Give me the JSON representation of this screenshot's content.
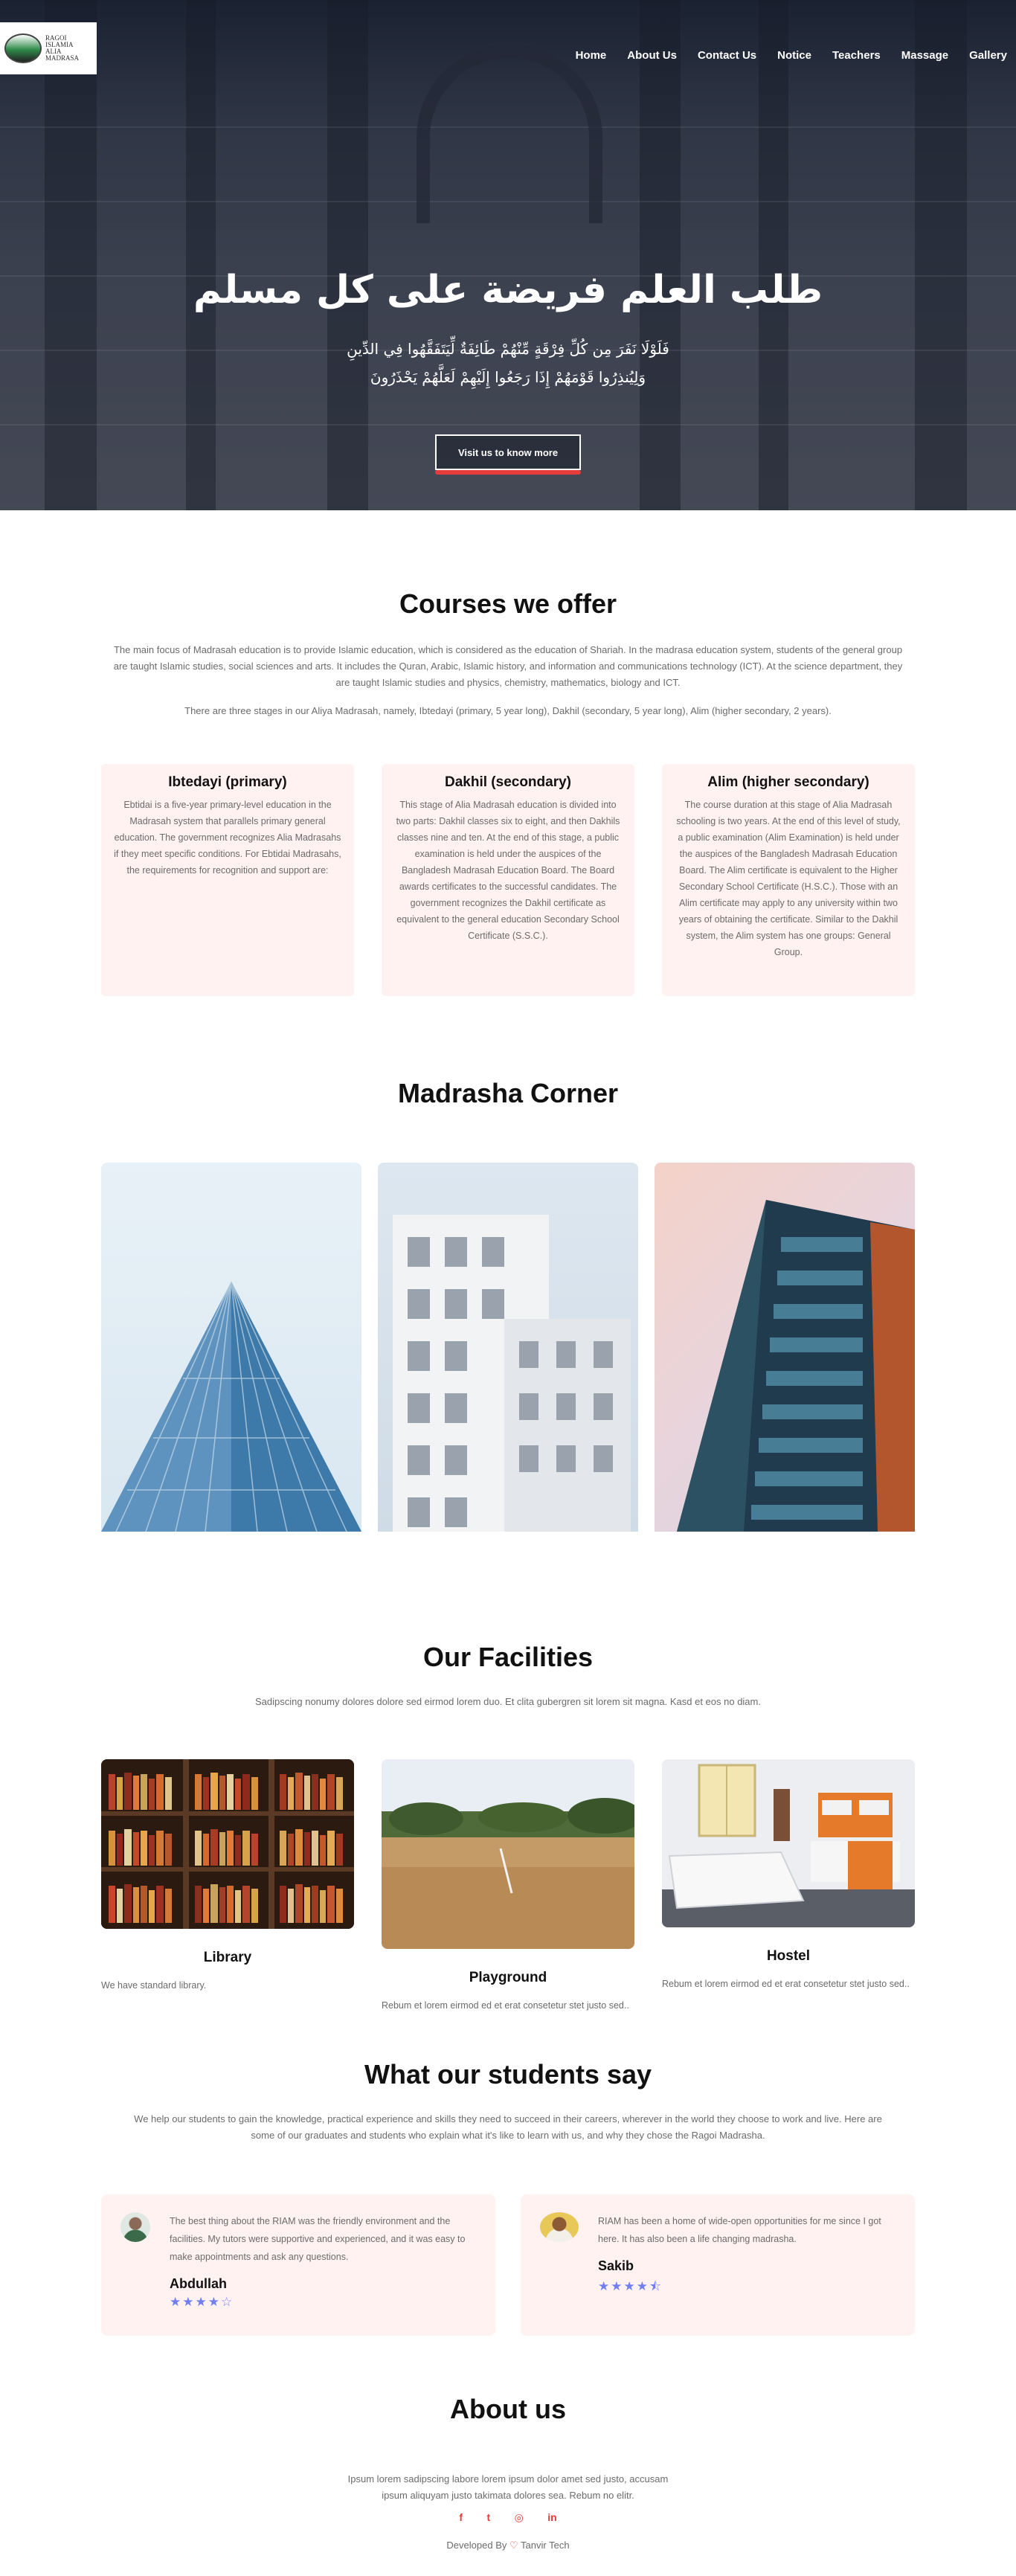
{
  "nav": {
    "logo_lines": [
      "RAGOI",
      "ISLAMIA",
      "ALIA",
      "MADRASA"
    ],
    "items": [
      "Home",
      "About Us",
      "Contact Us",
      "Notice",
      "Teachers",
      "Massage",
      "Gallery"
    ]
  },
  "hero": {
    "title": "طلب العلم فريضة على كل مسلم",
    "verse_line1": "فَلَوْلَا نَفَرَ مِن كُلِّ فِرْقَةٍ مِّنْهُمْ طَائِفَةٌ لِّيَتَفَقَّهُوا فِي الدِّينِ",
    "verse_line2": "وَلِيُنذِرُوا قَوْمَهُمْ إِذَا رَجَعُوا إِلَيْهِمْ لَعَلَّهُمْ يَحْذَرُونَ",
    "button_label": "Visit us to know more"
  },
  "courses": {
    "title": "Courses we offer",
    "intro": "The main focus of Madrasah education is to provide Islamic education, which is considered as the education of Shariah. In the madrasa education system, students of the general group are taught Islamic studies, social sciences and arts. It includes the Quran, Arabic, Islamic history, and information and communications technology (ICT). At the science department, they are taught Islamic studies and physics, chemistry, mathematics, biology and ICT.",
    "intro2": "There are three stages in our Aliya Madrasah, namely, Ibtedayi (primary, 5 year long), Dakhil (secondary, 5 year long), Alim (higher secondary, 2 years).",
    "cards": [
      {
        "title": "Ibtedayi (primary)",
        "text": "Ebtidai is a five-year primary-level education in the Madrasah system that parallels primary general education. The government recognizes Alia Madrasahs if they meet specific conditions. For Ebtidai Madrasahs, the requirements for recognition and support are:"
      },
      {
        "title": "Dakhil (secondary)",
        "text": "This stage of Alia Madrasah education is divided into two parts: Dakhil classes six to eight, and then Dakhils classes nine and ten. At the end of this stage, a public examination is held under the auspices of the Bangladesh Madrasah Education Board. The Board awards certificates to the successful candidates. The government recognizes the Dakhil certificate as equivalent to the general education Secondary School Certificate (S.S.C.)."
      },
      {
        "title": "Alim (higher secondary)",
        "text": "The course duration at this stage of Alia Madrasah schooling is two years. At the end of this level of study, a public examination (Alim Examination) is held under the auspices of the Bangladesh Madrasah Education Board. The Alim certificate is equivalent to the Higher Secondary School Certificate (H.S.C.). Those with an Alim certificate may apply to any university within two years of obtaining the certificate. Similar to the Dakhil system, the Alim system has one groups: General Group."
      }
    ]
  },
  "corner": {
    "title": "Madrasha Corner"
  },
  "facilities": {
    "title": "Our Facilities",
    "intro": "Sadipscing nonumy dolores dolore sed eirmod lorem duo. Et clita gubergren sit lorem sit magna. Kasd et eos no diam.",
    "items": [
      {
        "title": "Library",
        "text": "We have standard library."
      },
      {
        "title": "Playground",
        "text": "Rebum et lorem eirmod ed et erat consetetur stet justo sed.."
      },
      {
        "title": "Hostel",
        "text": "Rebum et lorem eirmod ed et erat consetetur stet justo sed.."
      }
    ]
  },
  "students": {
    "title": "What our students say",
    "intro": "We help our students to gain the knowledge, practical experience and skills they need to succeed in their careers, wherever in the world they choose to work and live. Here are some of our graduates and students who explain what it's like to learn with us, and why they chose the Ragoi Madrasha.",
    "testimonials": [
      {
        "quote": "The best thing about the RIAM was the friendly environment and the facilities. My tutors were supportive and experienced, and it was easy to make appointments and ask any questions.",
        "name": "Abdullah",
        "rating": 4,
        "stars": "★★★★☆"
      },
      {
        "quote": "RIAM has been a home of wide-open opportunities for me since I got here. It has also been a life changing madrasha.",
        "name": "Sakib",
        "rating": 4.5,
        "stars": "★★★★⯪"
      }
    ]
  },
  "about": {
    "title": "About us",
    "text": "Ipsum lorem sadipscing labore lorem ipsum dolor amet sed justo, accusam ipsum aliquyam justo takimata dolores sea. Rebum no elitr.",
    "socials": [
      "f",
      "t",
      "◎",
      "in"
    ],
    "developed_prefix": "Developed By",
    "heart": "♡",
    "developer": "Tanvir Tech"
  },
  "colors": {
    "accent": "#e63b3b",
    "card_bg": "#fff2f1",
    "star": "#6f7ff2"
  }
}
